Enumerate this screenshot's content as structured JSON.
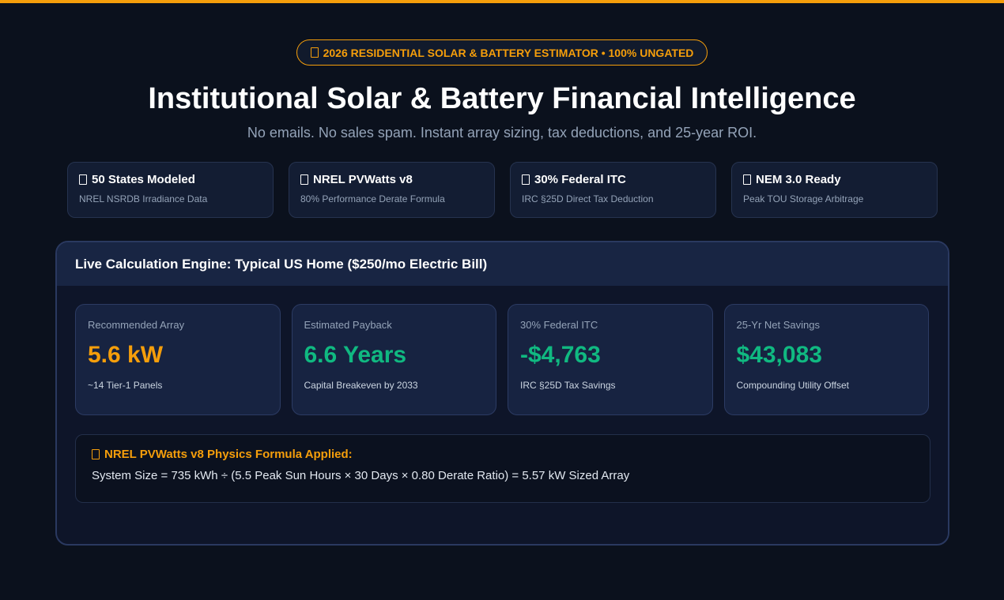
{
  "badge": {
    "icon": "box-icon",
    "text": "2026 RESIDENTIAL SOLAR & BATTERY ESTIMATOR • 100% UNGATED"
  },
  "hero": {
    "title": "Institutional Solar & Battery Financial Intelligence",
    "subtitle": "No emails. No sales spam. Instant array sizing, tax deductions, and 25-year ROI."
  },
  "features": [
    {
      "title": "50 States Modeled",
      "desc": "NREL NSRDB Irradiance Data"
    },
    {
      "title": "NREL PVWatts v8",
      "desc": "80% Performance Derate Formula"
    },
    {
      "title": "30% Federal ITC",
      "desc": "IRC §25D Direct Tax Deduction"
    },
    {
      "title": "NEM 3.0 Ready",
      "desc": "Peak TOU Storage Arbitrage"
    }
  ],
  "engine": {
    "title": "Live Calculation Engine: Typical US Home ($250/mo Electric Bill)",
    "metrics": [
      {
        "label": "Recommended Array",
        "value": "5.6 kW",
        "note": "~14 Tier-1 Panels"
      },
      {
        "label": "Estimated Payback",
        "value": "6.6 Years",
        "note": "Capital Breakeven by 2033"
      },
      {
        "label": "30% Federal ITC",
        "value": "-$4,763",
        "note": "IRC §25D Tax Savings"
      },
      {
        "label": "25-Yr Net Savings",
        "value": "$43,083",
        "note": "Compounding Utility Offset"
      }
    ],
    "formula": {
      "title": "NREL PVWatts v8 Physics Formula Applied:",
      "text": "System Size = 735 kWh ÷ (5.5 Peak Sun Hours × 30 Days × 0.80 Derate Ratio) = 5.57 kW Sized Array"
    }
  },
  "colors": {
    "accent": "#f59e0b",
    "positive": "#10b981",
    "background": "#0b111d"
  }
}
